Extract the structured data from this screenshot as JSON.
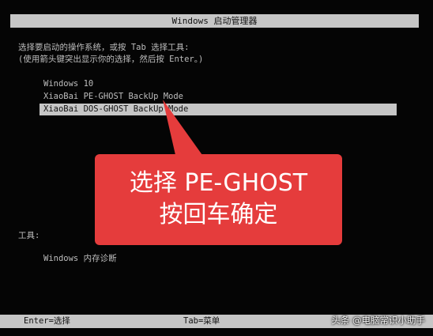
{
  "window": {
    "title": "Windows 启动管理器"
  },
  "instructions": {
    "line1": "选择要启动的操作系统，或按 Tab 选择工具:",
    "line2": "(使用箭头键突出显示你的选择，然后按 Enter。)"
  },
  "os_menu": {
    "items": [
      {
        "label": "Windows 10",
        "selected": false
      },
      {
        "label": "XiaoBai PE-GHOST BackUp Mode",
        "selected": false
      },
      {
        "label": "XiaoBai DOS-GHOST BackUp Mode",
        "selected": true
      }
    ]
  },
  "tools": {
    "heading": "工具:",
    "items": [
      {
        "label": "Windows 内存诊断"
      }
    ]
  },
  "footer": {
    "enter_hint": "Enter=选择",
    "tab_hint": "Tab=菜单"
  },
  "annotation": {
    "line1": "选择 PE-GHOST",
    "line2": "按回车确定",
    "color": "#e53c3c"
  },
  "watermark": {
    "text": "头条 @电脑常识小助手"
  },
  "colors": {
    "background": "#050505",
    "bar": "#c6c6c6",
    "text": "#bdbdbd"
  }
}
